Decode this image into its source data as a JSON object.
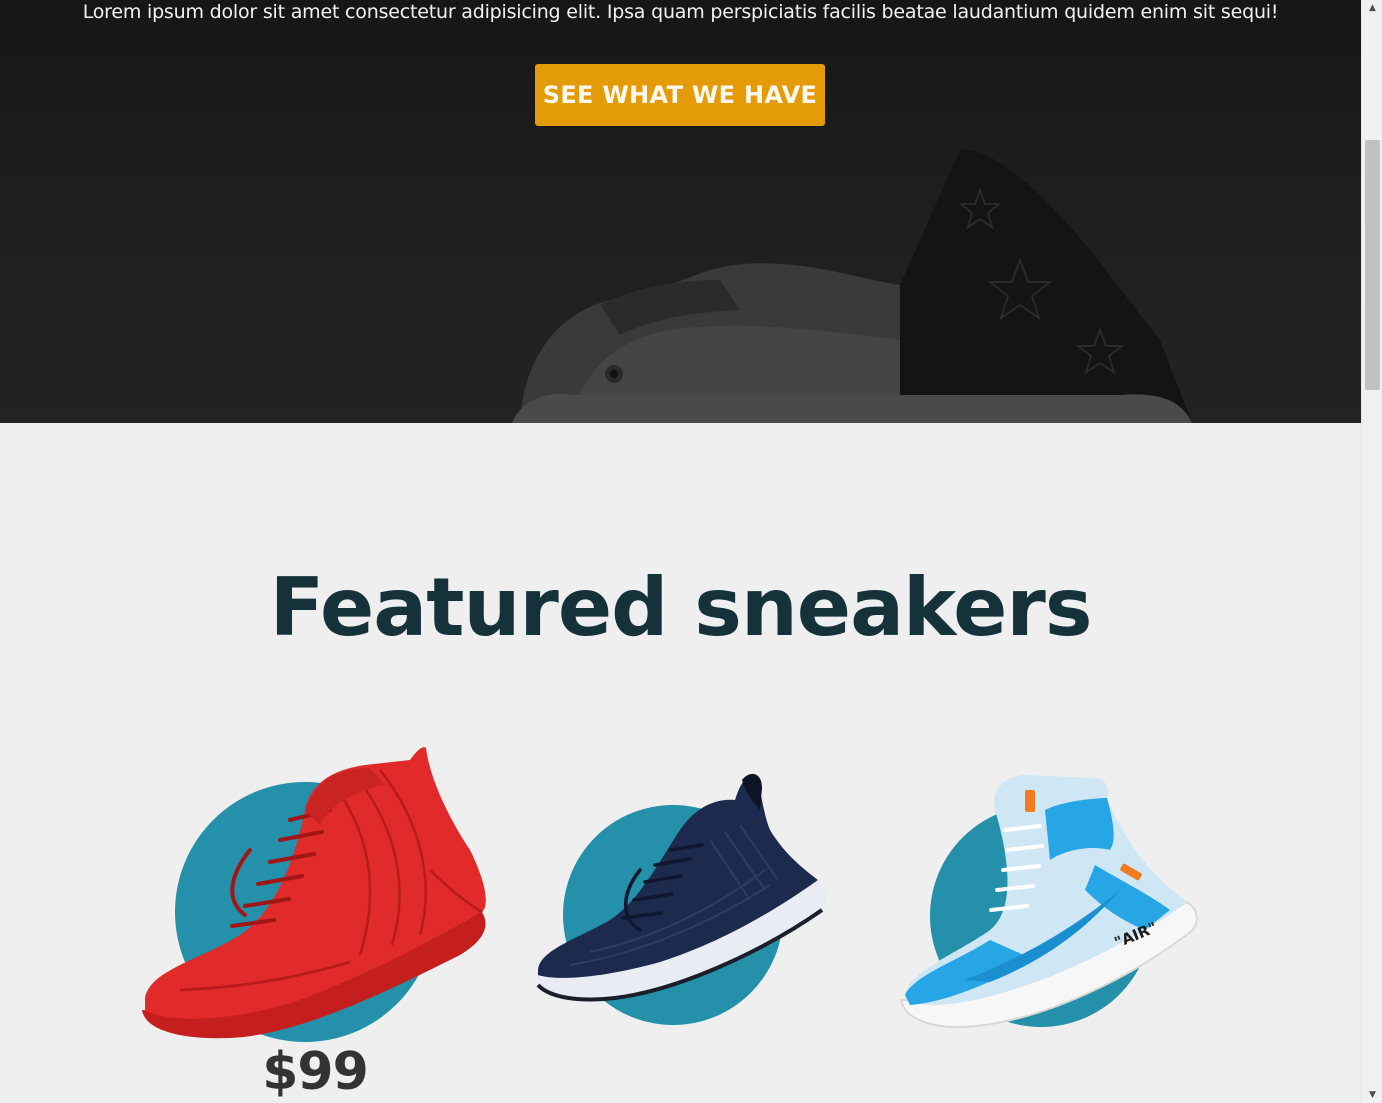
{
  "hero": {
    "text": "Lorem ipsum dolor sit amet consectetur adipisicing elit. Ipsa quam perspiciatis facilis beatae laudantium quidem enim sit sequi!",
    "button_label": "SEE WHAT WE HAVE",
    "colors": {
      "background": "#1a1a1a",
      "button": "#e39b07"
    }
  },
  "featured": {
    "title": "Featured sneakers",
    "products": [
      {
        "icon": "red-sneaker-image",
        "price": "$99"
      },
      {
        "icon": "navy-running-shoe-image"
      },
      {
        "icon": "blue-high-top-sneaker-image",
        "shoe_text": "\"AIR\""
      }
    ],
    "colors": {
      "title": "#15313a",
      "circle": "#2490aa"
    }
  },
  "scrollbar": {
    "up_icon": "scroll-up-arrow-icon",
    "down_icon": "scroll-down-arrow-icon"
  }
}
